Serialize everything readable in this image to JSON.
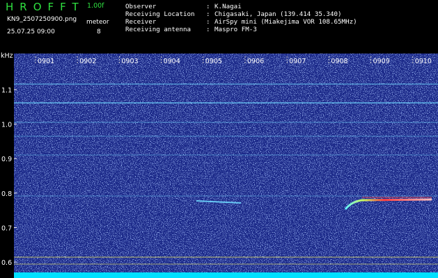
{
  "header": {
    "title": "HROFFT",
    "version": "1.00f",
    "filename": "KN9_2507250900.png",
    "meteor_label": "meteor",
    "meteor_count": "8",
    "datetime": "25.07.25 09:00"
  },
  "info": [
    {
      "key": "Observer",
      "value": "K.Nagai"
    },
    {
      "key": "Receiving Location",
      "value": "Chigasaki, Japan (139.414 35.340)"
    },
    {
      "key": "Receiver",
      "value": "AirSpy mini (Miakejima VOR 108.65MHz)"
    },
    {
      "key": "Receiving antenna",
      "value": "Maspro FM-3"
    }
  ],
  "spectrogram": {
    "y_unit": "kHz",
    "y_ticks": [
      "1.1",
      "1.0",
      "0.9",
      "0.8",
      "0.7",
      "0.6"
    ],
    "time_labels": [
      "0901",
      "0902",
      "0903",
      "0904",
      "0905",
      "0906",
      "0907",
      "0908",
      "0909",
      "0910"
    ],
    "background_color": "#1a2a8a",
    "noise_color": "#5a7bff",
    "line_color": "#6fd8ff",
    "echo_color": "#ff4040",
    "baseline_color": "#00e0ff",
    "guide_line_color": "#d8d870"
  }
}
